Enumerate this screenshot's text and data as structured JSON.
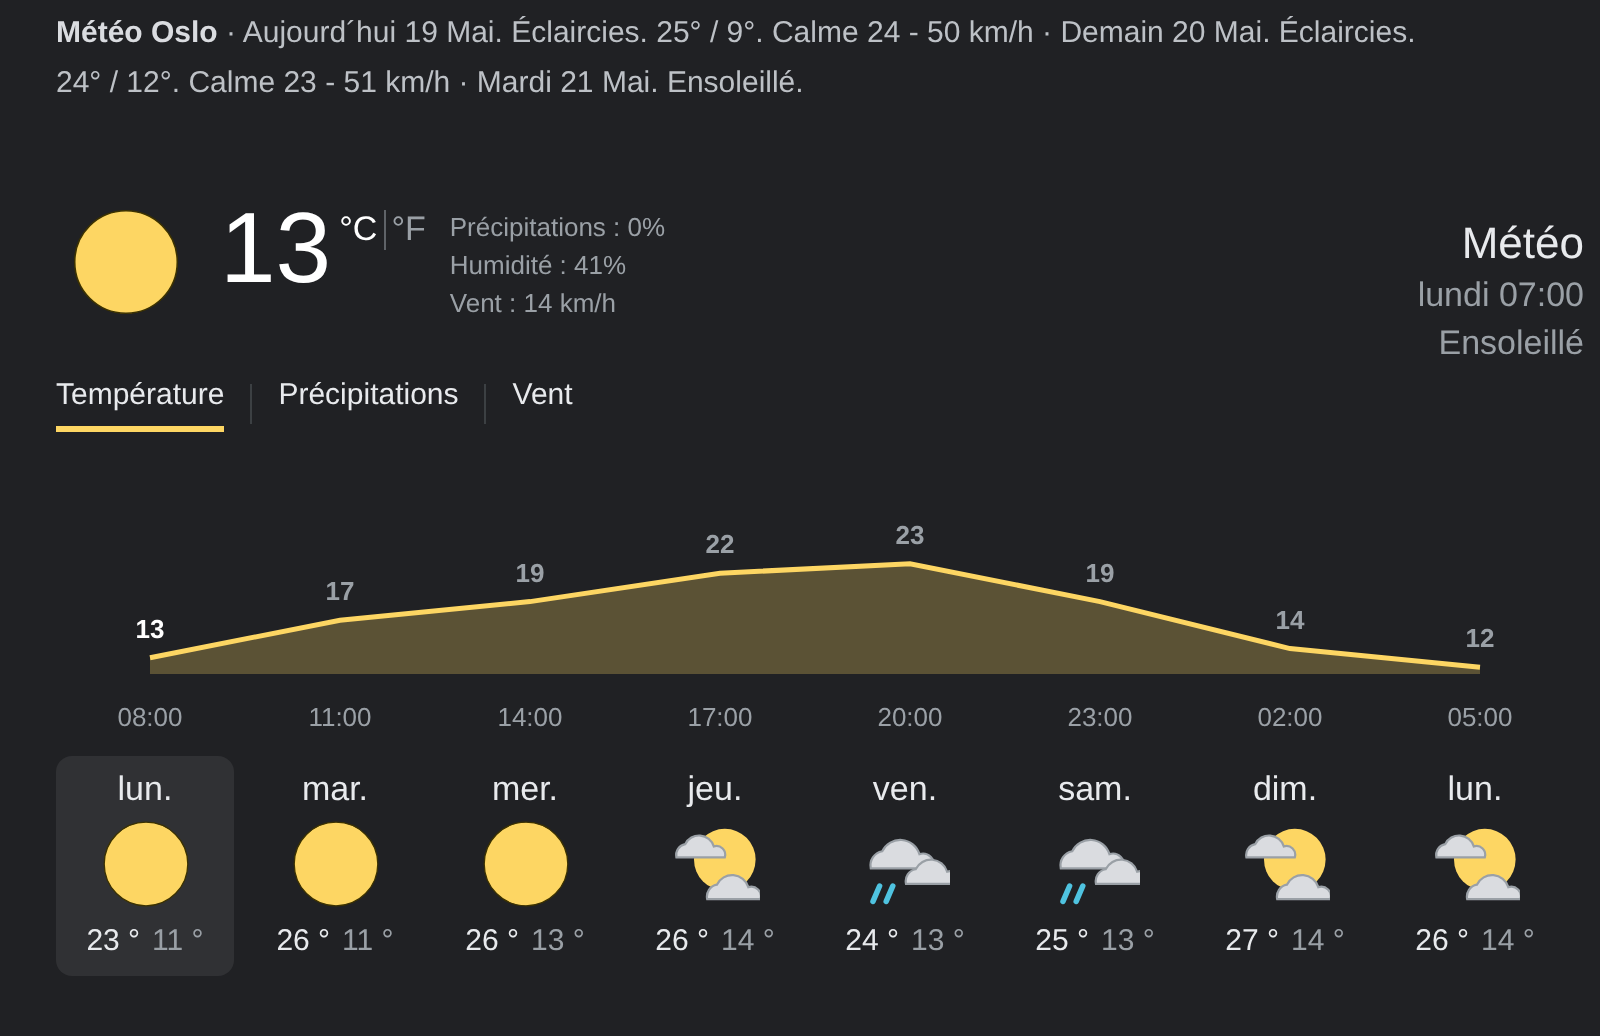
{
  "summary": "**Météo Oslo** · Aujourd´hui 19 Mai. Éclaircies. 25° / 9°. Calme 24 - 50 km/h · Demain 20 Mai. Éclaircies. 24° / 12°. Calme 23 - 51 km/h · Mardi 21 Mai. Ensoleillé.",
  "current": {
    "kind": "sun",
    "temperature": "13",
    "units": [
      {
        "label": "°C",
        "selected": true
      },
      {
        "label": "°F",
        "selected": false
      }
    ],
    "details": [
      "Précipitations : 0%",
      "Humidité : 41%",
      "Vent : 14 km/h"
    ],
    "title": "Météo",
    "time": "lundi 07:00",
    "condition": "Ensoleillé"
  },
  "tabs": [
    {
      "label": "Température",
      "selected": true
    },
    {
      "label": "Précipitations",
      "selected": false
    },
    {
      "label": "Vent",
      "selected": false
    }
  ],
  "chart": {
    "chart_data": {
      "type": "area",
      "categories": [
        "08:00",
        "11:00",
        "14:00",
        "17:00",
        "20:00",
        "23:00",
        "02:00",
        "05:00"
      ],
      "series": [
        {
          "color": "#fdd663",
          "values": [
            13,
            17,
            19,
            22,
            23,
            19,
            14,
            12
          ]
        }
      ],
      "data_labels": true
    }
  },
  "days": [
    {
      "day": "lun.",
      "kind": "sun",
      "high": "23 °",
      "low": "11 °",
      "selected": true
    },
    {
      "day": "mar.",
      "kind": "sun",
      "high": "26 °",
      "low": "11 °",
      "selected": false
    },
    {
      "day": "mer.",
      "kind": "sun",
      "high": "26 °",
      "low": "13 °",
      "selected": false
    },
    {
      "day": "jeu.",
      "kind": "partly_cloudy",
      "high": "26 °",
      "low": "14 °",
      "selected": false
    },
    {
      "day": "ven.",
      "kind": "rain",
      "high": "24 °",
      "low": "13 °",
      "selected": false
    },
    {
      "day": "sam.",
      "kind": "rain",
      "high": "25 °",
      "low": "13 °",
      "selected": false
    },
    {
      "day": "dim.",
      "kind": "partly_cloudy",
      "high": "27 °",
      "low": "14 °",
      "selected": false
    },
    {
      "day": "lun.",
      "kind": "partly_cloudy",
      "high": "26 °",
      "low": "14 °",
      "selected": false
    }
  ]
}
